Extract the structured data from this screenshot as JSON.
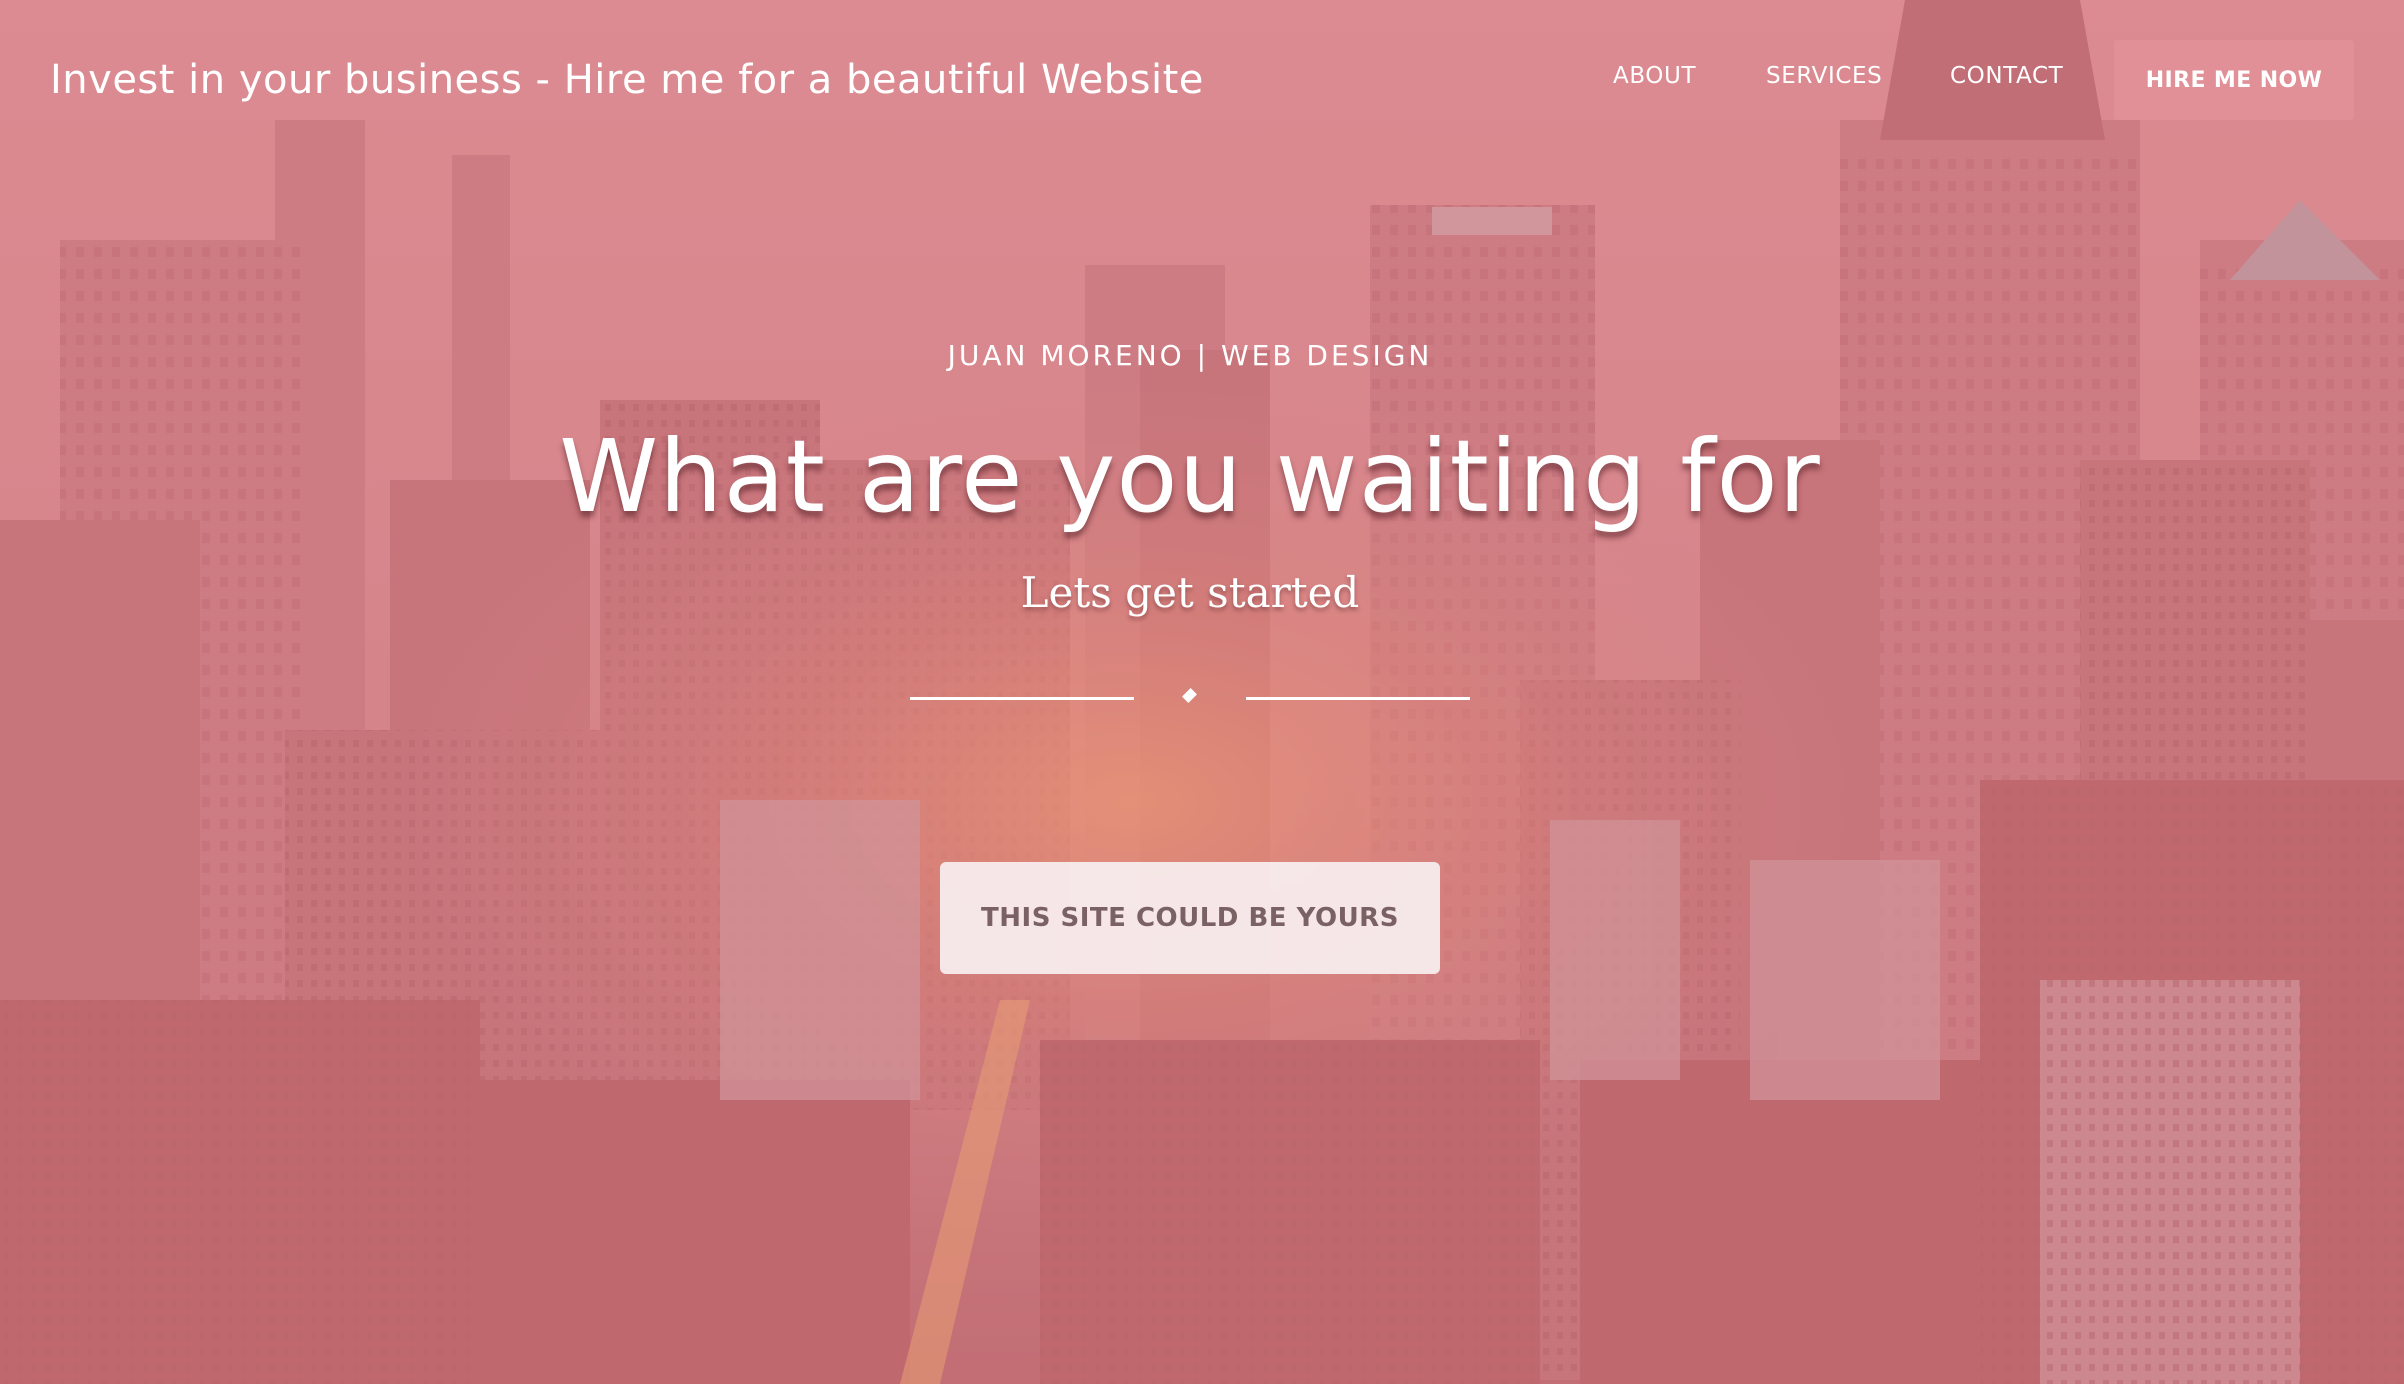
{
  "header": {
    "brand": "Invest in your business - Hire me for a beautiful Website",
    "nav": {
      "about": "ABOUT",
      "services": "SERVICES",
      "contact": "CONTACT"
    },
    "hire_button": "HIRE ME NOW"
  },
  "hero": {
    "eyebrow": "JUAN MORENO | WEB DESIGN",
    "title": "What are you waiting for",
    "subtitle": "Lets get started",
    "cta_button": "THIS SITE COULD BE YOURS"
  },
  "colors": {
    "overlay": "#d6787f",
    "cta_text": "#7a6264",
    "text": "#ffffff"
  },
  "icons": {
    "divider": "diamond-icon"
  }
}
